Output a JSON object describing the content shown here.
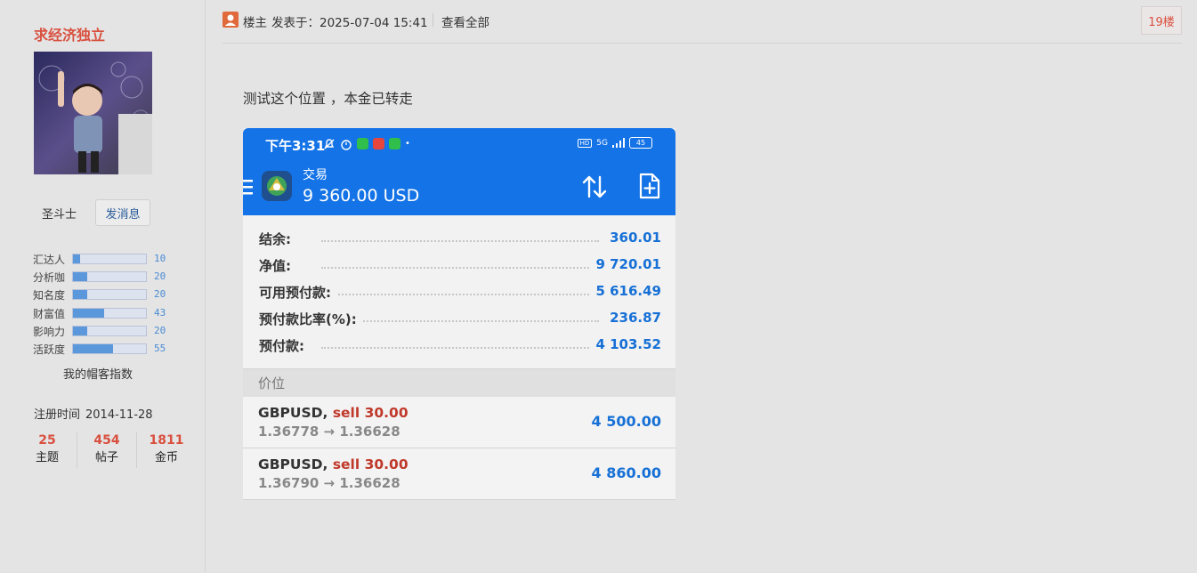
{
  "user": {
    "name": "求经济独立",
    "rank": "圣斗士",
    "message_button": "发消息",
    "stats": [
      {
        "name": "汇达人",
        "value": 10
      },
      {
        "name": "分析咖",
        "value": 20
      },
      {
        "name": "知名度",
        "value": 20
      },
      {
        "name": "财富值",
        "value": 43
      },
      {
        "name": "影响力",
        "value": 20
      },
      {
        "name": "活跃度",
        "value": 55
      }
    ],
    "blog_index_link": "我的帽客指数",
    "register_label": "注册时间",
    "register_date": "2014-11-28",
    "counts": [
      {
        "value": "25",
        "label": "主题"
      },
      {
        "value": "454",
        "label": "帖子"
      },
      {
        "value": "1811",
        "label": "金币"
      }
    ]
  },
  "post": {
    "owner_label": "楼主",
    "posted_at": "发表于：2025-07-04 15:41",
    "view_all": "查看全部",
    "floor": "19楼",
    "text": "测试这个位置 ，本金已转走"
  },
  "screenshot": {
    "status_time": "下午3:31",
    "network": "5G",
    "battery": "45",
    "app_title": "交易",
    "balance_header": "9 360.00 USD",
    "account": [
      {
        "label": "结余:",
        "value": "360.01"
      },
      {
        "label": "净值:",
        "value": "9 720.01"
      },
      {
        "label": "可用预付款:",
        "value": "5 616.49"
      },
      {
        "label": "预付款比率(%):",
        "value": "236.87"
      },
      {
        "label": "预付款:",
        "value": "4 103.52"
      }
    ],
    "section_label": "价位",
    "positions": [
      {
        "symbol": "GBPUSD,",
        "side": "sell 30.00",
        "prices": "1.36778 → 1.36628",
        "profit": "4 500.00"
      },
      {
        "symbol": "GBPUSD,",
        "side": "sell 30.00",
        "prices": "1.36790 → 1.36628",
        "profit": "4 860.00"
      }
    ]
  }
}
